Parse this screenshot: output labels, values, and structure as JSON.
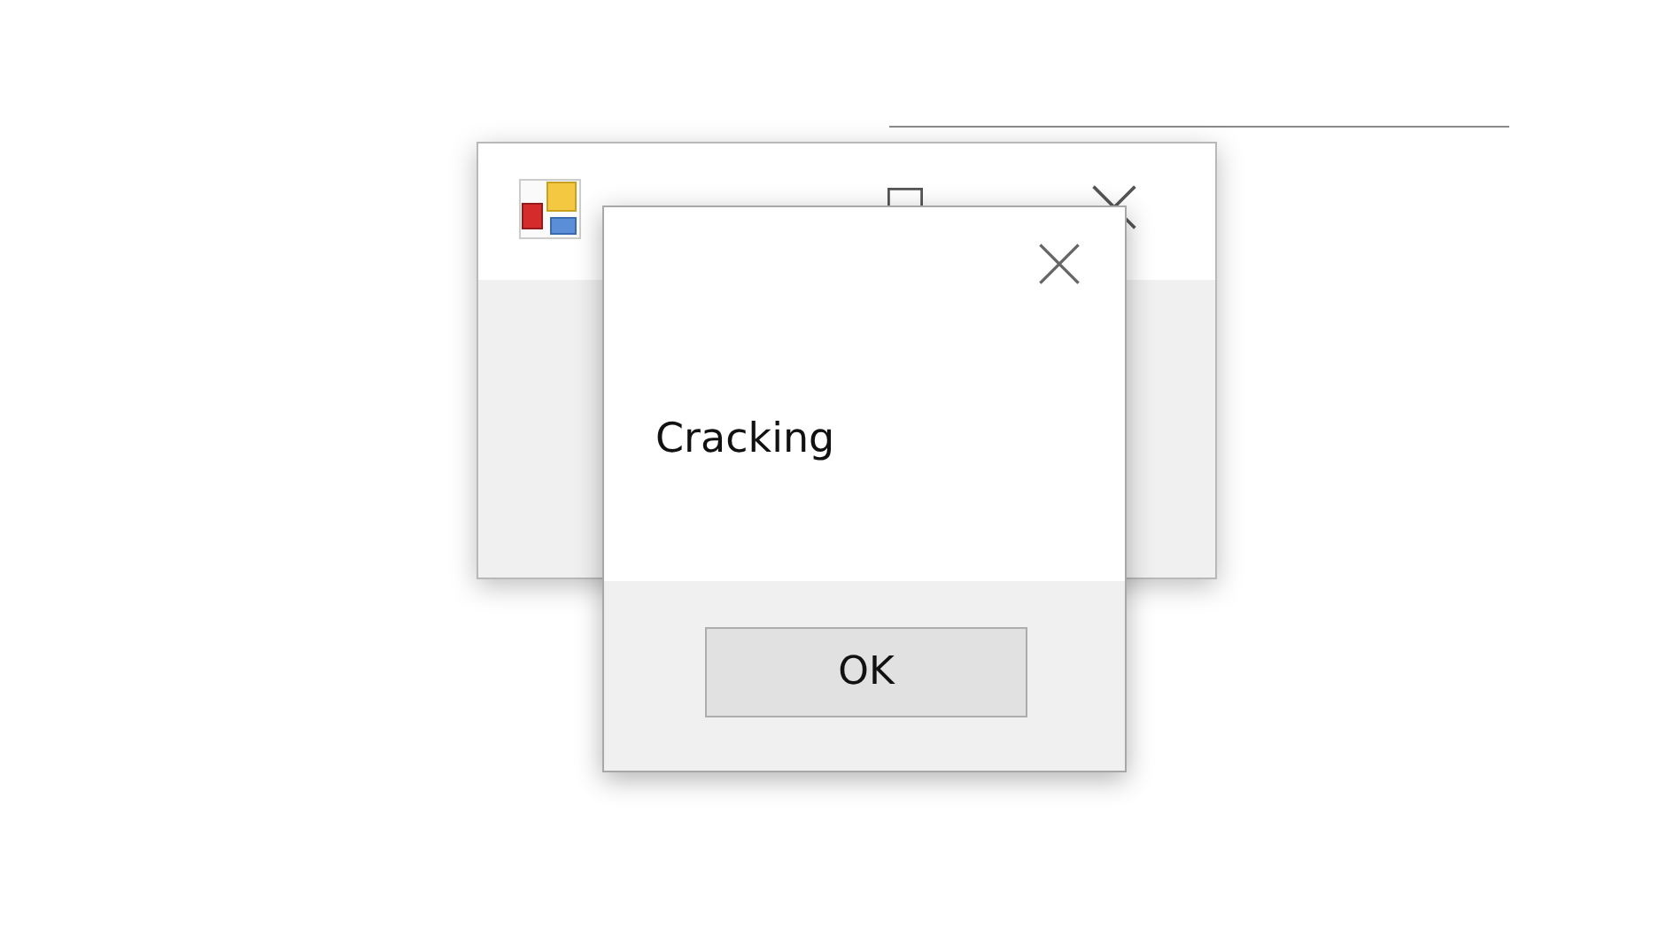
{
  "dialog": {
    "message": "Cracking",
    "buttons": [
      "OK"
    ]
  }
}
